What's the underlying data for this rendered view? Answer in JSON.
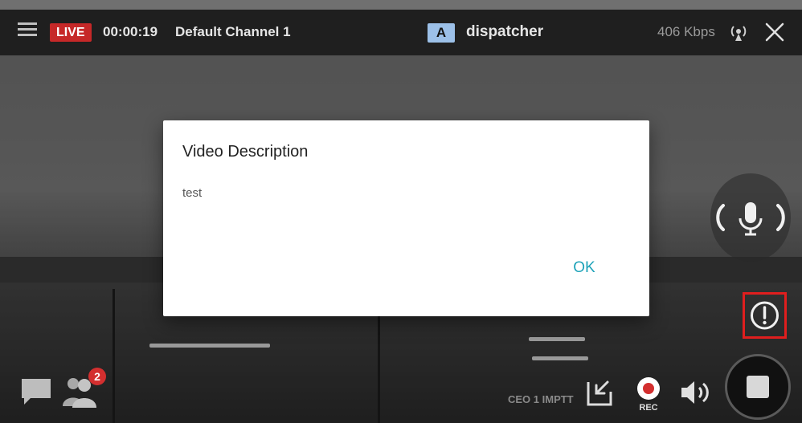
{
  "top_bar": {
    "live_label": "LIVE",
    "live_time": "00:00:19",
    "channel_name": "Default Channel 1",
    "user_badge": "A",
    "user_name": "dispatcher",
    "bitrate": "406 Kbps"
  },
  "dialog": {
    "title": "Video Description",
    "body": "test",
    "ok_label": "OK"
  },
  "bottom_bar": {
    "user_count": "2",
    "watermark": "CEO 1 IMPTT",
    "rec_label": "REC"
  },
  "colors": {
    "live_red": "#c62828",
    "accent_teal": "#1fa3b9",
    "alert_highlight": "#e01e1e",
    "badge_blue": "#9cc0e8"
  },
  "icons": [
    "menu-icon",
    "signal-icon",
    "close-icon",
    "mic-icon",
    "alert-icon",
    "stop-icon",
    "chat-icon",
    "users-icon",
    "pip-icon",
    "record-icon",
    "volume-icon"
  ]
}
